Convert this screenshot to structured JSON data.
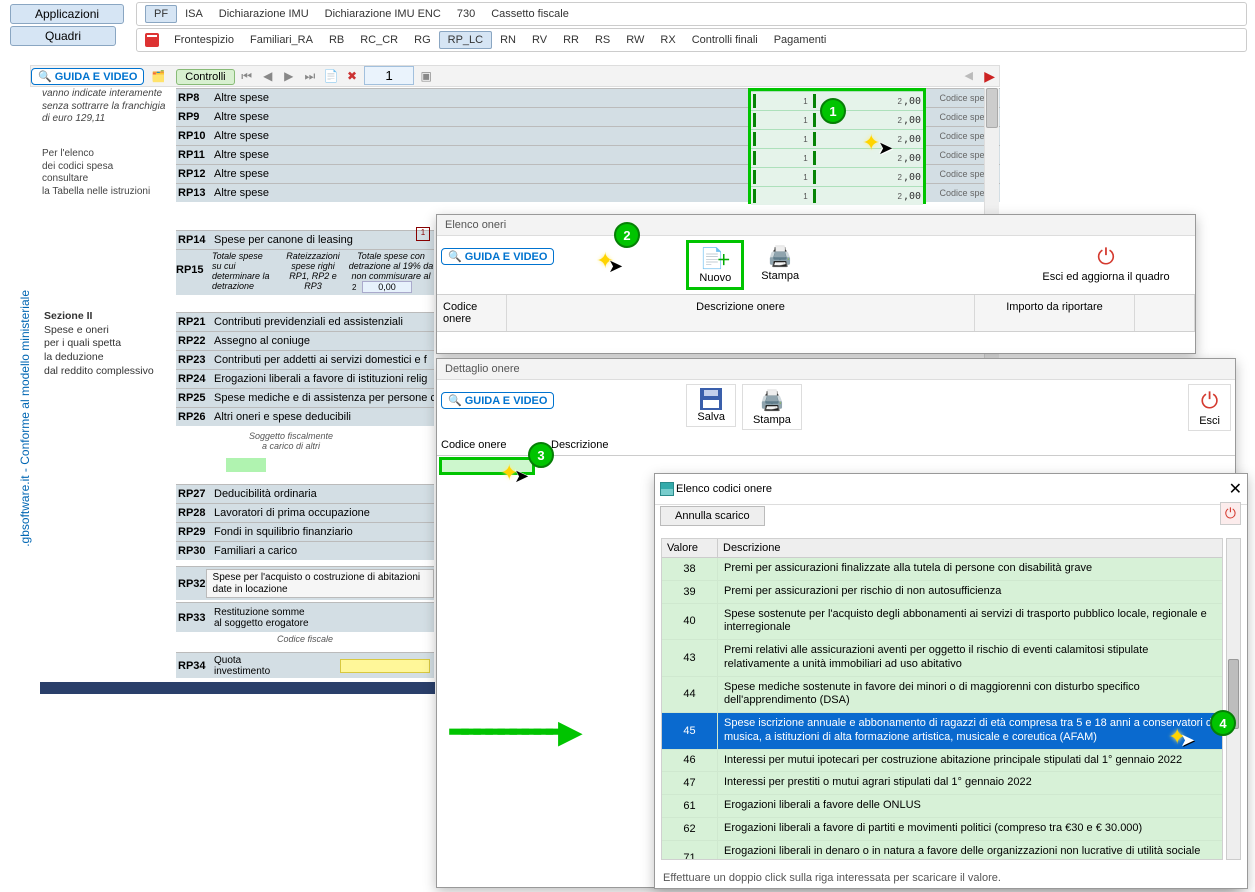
{
  "topButtons": {
    "applicazioni": "Applicazioni",
    "quadri": "Quadri"
  },
  "tabs1": [
    "PF",
    "ISA",
    "Dichiarazione IMU",
    "Dichiarazione IMU ENC",
    "730",
    "Cassetto fiscale"
  ],
  "tabs1_active": 0,
  "tabs2": [
    "Frontespizio",
    "Familiari_RA",
    "RB",
    "RC_CR",
    "RG",
    "RP_LC",
    "RN",
    "RV",
    "RR",
    "RS",
    "RW",
    "RX",
    "Controlli finali",
    "Pagamenti"
  ],
  "tabs2_active": 5,
  "guideBar": {
    "guide": "GUIDA E VIDEO",
    "controlli": "Controlli",
    "page": "1"
  },
  "sideNote1": "vanno indicate interamente senza sottrarre la franchigia di euro 129,11",
  "sideNote2": "Per l'elenco\ndei codici spesa\nconsultare\nla Tabella nelle istruzioni",
  "verticalText": ".gbsoftware.it - Conforme al modello ministeriale",
  "codiceSpesaLabel": "Codice spesa",
  "rpRows": [
    {
      "code": "RP8",
      "label": "Altre spese"
    },
    {
      "code": "RP9",
      "label": "Altre spese"
    },
    {
      "code": "RP10",
      "label": "Altre spese"
    },
    {
      "code": "RP11",
      "label": "Altre spese"
    },
    {
      "code": "RP12",
      "label": "Altre spese"
    },
    {
      "code": "RP13",
      "label": "Altre spese"
    }
  ],
  "greenFieldRows": [
    {
      "sup1": "1",
      "sup2": "2",
      "val": ",00"
    },
    {
      "sup1": "1",
      "sup2": "2",
      "val": ",00"
    },
    {
      "sup1": "1",
      "sup2": "2",
      "val": ",00"
    },
    {
      "sup1": "1",
      "sup2": "2",
      "val": ",00"
    },
    {
      "sup1": "1",
      "sup2": "2",
      "val": ",00"
    },
    {
      "sup1": "1",
      "sup2": "2",
      "val": ",00"
    }
  ],
  "rp14": {
    "code": "RP14",
    "label": "Spese per canone di leasing"
  },
  "rp15": {
    "code": "RP15",
    "c1": "Totale spese su cui determinare la detrazione",
    "c2": "Rateizzazioni spese righi RP1, RP2 e RP3",
    "c3": "Totale spese con detrazione al 19% da non commisurare al reddito",
    "sup": "2",
    "val": "0,00"
  },
  "section2": {
    "title": "Sezione II",
    "l1": "Spese e oneri",
    "l2": "per i quali spetta",
    "l3": "la deduzione",
    "l4": "dal reddito complessivo"
  },
  "rpLower": [
    {
      "code": "RP21",
      "label": "Contributi previdenziali ed assistenziali"
    },
    {
      "code": "RP22",
      "label": "Assegno al coniuge"
    },
    {
      "code": "RP23",
      "label": "Contributi per addetti ai servizi domestici e f"
    },
    {
      "code": "RP24",
      "label": "Erogazioni liberali a favore di istituzioni relig"
    },
    {
      "code": "RP25",
      "label": "Spese mediche e di assistenza per persone c"
    },
    {
      "code": "RP26",
      "label": "Altri oneri e spese deducibili"
    }
  ],
  "rp26note": "Soggetto fiscalmente\na carico di altri",
  "rpLower2": [
    {
      "code": "RP27",
      "label": "Deducibilità ordinaria"
    },
    {
      "code": "RP28",
      "label": "Lavoratori di prima occupazione"
    },
    {
      "code": "RP29",
      "label": "Fondi in squilibrio finanziario"
    },
    {
      "code": "RP30",
      "label": "Familiari a carico"
    }
  ],
  "rp32": {
    "code": "RP32",
    "btn": "Spese per l'acquisto o costruzione di abitazioni date in locazione"
  },
  "rp33": {
    "code": "RP33",
    "l1": "Restituzione somme",
    "l2": "al soggetto erogatore"
  },
  "rp33cf": "Codice fiscale",
  "rp34": {
    "code": "RP34",
    "l1": "Quota",
    "l2": "investimento"
  },
  "elencoOneri": {
    "title": "Elenco oneri",
    "nuovo": "Nuovo",
    "stampa": "Stampa",
    "esci": "Esci ed aggiorna il quadro",
    "th1": "Codice onere",
    "th2": "Descrizione onere",
    "th3": "Importo da riportare"
  },
  "dettaglio": {
    "title": "Dettaglio onere",
    "salva": "Salva",
    "stampa": "Stampa",
    "esci": "Esci",
    "codice": "Codice onere",
    "descr": "Descrizione"
  },
  "elencoCodici": {
    "title": "Elenco codici onere",
    "annulla": "Annulla scarico",
    "th1": "Valore",
    "th2": "Descrizione",
    "rows": [
      {
        "v": "38",
        "d": "Premi per assicurazioni  finalizzate alla tutela di persone con disabilità grave"
      },
      {
        "v": "39",
        "d": "Premi per assicurazioni per rischio di non autosufficienza"
      },
      {
        "v": "40",
        "d": "Spese sostenute per l'acquisto degli abbonamenti ai servizi di trasporto pubblico locale, regionale e interregionale"
      },
      {
        "v": "43",
        "d": "Premi relativi alle assicurazioni aventi per oggetto il rischio di eventi calamitosi stipulate relativamente a unità immobiliari ad uso abitativo"
      },
      {
        "v": "44",
        "d": "Spese mediche sostenute in favore dei minori o di maggiorenni con disturbo specifico dell'apprendimento (DSA)"
      },
      {
        "v": "45",
        "d": "Spese iscrizione annuale e abbonamento di ragazzi di età compresa tra 5 e 18 anni a conservatori di musica, a istituzioni di alta formazione artistica, musicale e coreutica (AFAM)",
        "sel": true
      },
      {
        "v": "46",
        "d": "Interessi per mutui ipotecari per costruzione abitazione principale stipulati dal 1° gennaio 2022"
      },
      {
        "v": "47",
        "d": "Interessi per prestiti o mutui agrari stipulati dal 1° gennaio 2022"
      },
      {
        "v": "61",
        "d": "Erogazioni liberali a favore delle ONLUS"
      },
      {
        "v": "62",
        "d": "Erogazioni liberali a favore di partiti e movimenti politici (compreso tra €30 e € 30.000)"
      },
      {
        "v": "71",
        "d": "Erogazioni liberali in denaro o in natura a favore delle organizzazioni non lucrative di utilità sociale (ONLUS) e delle associazioni di promozione sociale"
      }
    ],
    "footer": "Effettuare un doppio click sulla riga interessata per scaricare il valore."
  }
}
